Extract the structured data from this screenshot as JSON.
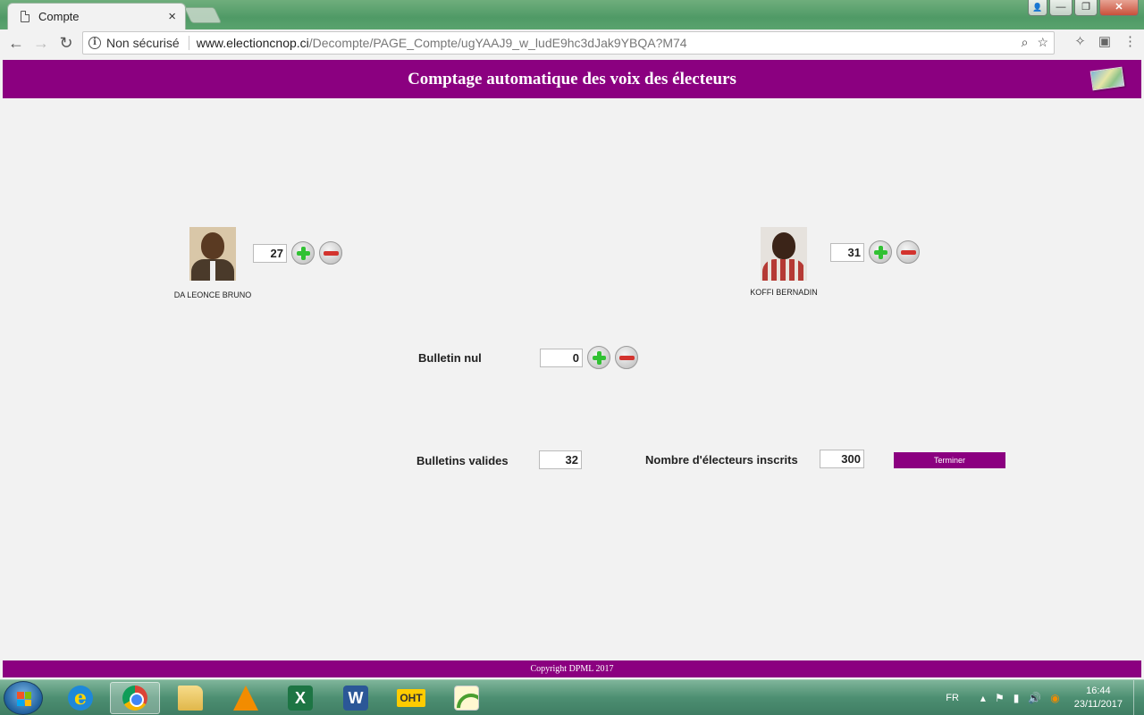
{
  "browser": {
    "tab_title": "Compte",
    "tab_close": "×",
    "security_label": "Non sécurisé",
    "url_host": "www.electioncnop.ci",
    "url_path": "/Decompte/PAGE_Compte/ugYAAJ9_w_ludE9hc3dJak9YBQA?M74",
    "back_icon": "←",
    "forward_icon": "→",
    "reload_icon": "↻",
    "zoom_icon": "⌕",
    "star_icon": "☆",
    "menu_icon": "⋮",
    "window_min": "—",
    "window_max": "❐",
    "window_close": "✕",
    "user_icon": "👤"
  },
  "page": {
    "header_title": "Comptage automatique des voix des électeurs",
    "candidates": [
      {
        "name": "DA LEONCE BRUNO",
        "votes": "27"
      },
      {
        "name": "KOFFI BERNADIN",
        "votes": "31"
      }
    ],
    "bulletin_nul": {
      "label": "Bulletin nul",
      "value": "0"
    },
    "bulletins_valides": {
      "label": "Bulletins valides",
      "value": "32"
    },
    "electeurs_inscrits": {
      "label": "Nombre d'électeurs inscrits",
      "value": "300"
    },
    "terminer_label": "Terminer",
    "footer": "Copyright DPML 2017"
  },
  "taskbar": {
    "apps": [
      "internet-explorer",
      "google-chrome",
      "file-explorer",
      "vlc",
      "excel",
      "word",
      "oht",
      "wifi-app"
    ],
    "word_label": "W",
    "excel_label": "X",
    "ie_label": "e",
    "oht_label": "OHT",
    "tray": {
      "language": "FR",
      "time": "16:44",
      "date": "23/11/2017"
    }
  },
  "colors": {
    "brand_purple": "#8b0080",
    "page_background": "#f2f2f2"
  }
}
